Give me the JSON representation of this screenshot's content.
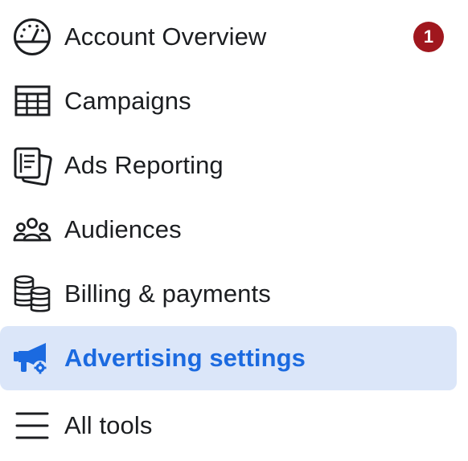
{
  "menu": {
    "items": [
      {
        "label": "Account Overview",
        "icon": "gauge-icon",
        "badge": "1",
        "active": false
      },
      {
        "label": "Campaigns",
        "icon": "table-icon",
        "active": false
      },
      {
        "label": "Ads Reporting",
        "icon": "report-icon",
        "active": false
      },
      {
        "label": "Audiences",
        "icon": "audience-icon",
        "active": false
      },
      {
        "label": "Billing & payments",
        "icon": "coins-icon",
        "active": false
      },
      {
        "label": "Advertising settings",
        "icon": "megaphone-gear-icon",
        "active": true
      },
      {
        "label": "All tools",
        "icon": "hamburger-icon",
        "active": false
      }
    ]
  },
  "colors": {
    "text": "#1c1e21",
    "active_text": "#1b6ae0",
    "active_background": "#dbe6f9",
    "badge": "#a0171e",
    "badge_text": "#ffffff"
  }
}
